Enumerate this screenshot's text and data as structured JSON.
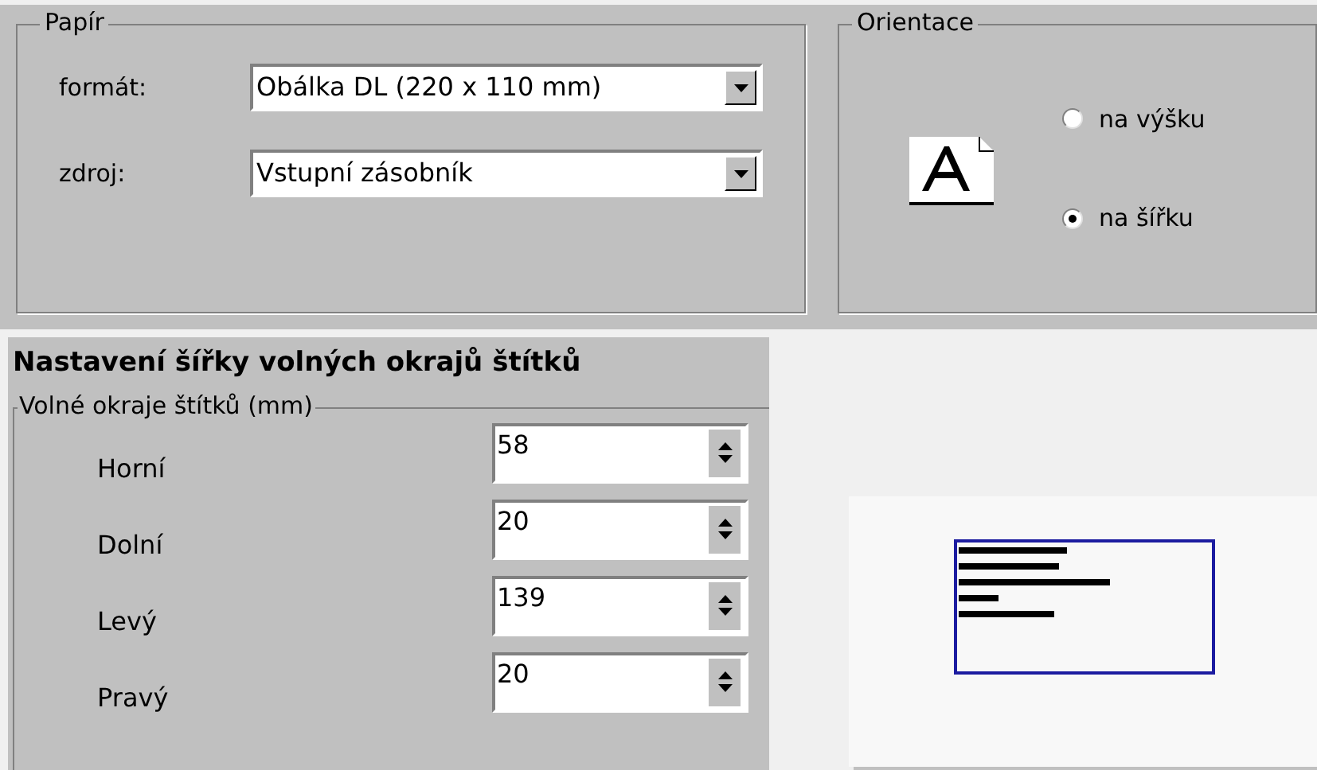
{
  "paper": {
    "title": "Papír",
    "fields": [
      {
        "label": "formát:",
        "value": "Obálka DL (220 x 110 mm)"
      },
      {
        "label": "zdroj:",
        "value": "Vstupní zásobník"
      }
    ]
  },
  "orientation": {
    "title": "Orientace",
    "options": [
      {
        "label": "na výšku",
        "selected": false
      },
      {
        "label": "na šířku",
        "selected": true
      }
    ]
  },
  "margins": {
    "heading": "Nastavení šířky volných okrajů štítků",
    "group_title": "Volné okraje štítků (mm)",
    "rows": [
      {
        "label": "Horní",
        "value": "58"
      },
      {
        "label": "Dolní",
        "value": "20"
      },
      {
        "label": "Levý",
        "value": "139"
      },
      {
        "label": "Pravý",
        "value": "20"
      }
    ]
  }
}
